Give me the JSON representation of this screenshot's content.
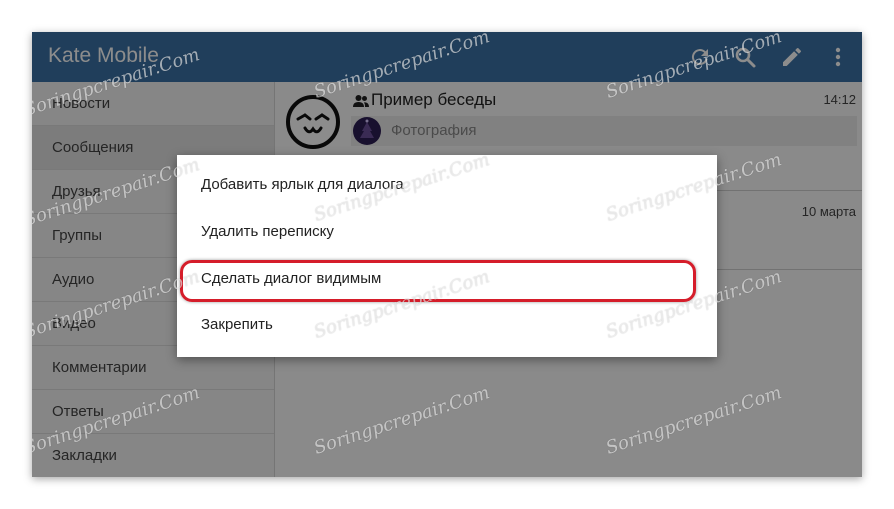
{
  "app": {
    "title": "Kate Mobile"
  },
  "toolbar": {
    "icons": [
      "refresh-icon",
      "search-icon",
      "edit-pencil-icon",
      "overflow-menu-icon"
    ]
  },
  "sidebar": {
    "items": [
      {
        "label": "Новости"
      },
      {
        "label": "Сообщения"
      },
      {
        "label": "Друзья"
      },
      {
        "label": "Группы"
      },
      {
        "label": "Аудио"
      },
      {
        "label": "Видео"
      },
      {
        "label": "Комментарии"
      },
      {
        "label": "Ответы"
      },
      {
        "label": "Закладки"
      }
    ]
  },
  "conversations": [
    {
      "title": "Пример беседы",
      "time": "14:12",
      "preview": "Фотография"
    },
    {
      "title": "",
      "time": "10 марта",
      "preview": ""
    }
  ],
  "context_menu": {
    "items": [
      {
        "label": "Добавить ярлык для диалога"
      },
      {
        "label": "Удалить переписку"
      },
      {
        "label": "Сделать диалог видимым"
      },
      {
        "label": "Закрепить"
      }
    ],
    "highlighted_index": 2
  },
  "watermark": {
    "text": "Soringpcrepair.Com"
  },
  "colors": {
    "appbar": "#3b72a6",
    "highlight": "#d51d2a"
  }
}
